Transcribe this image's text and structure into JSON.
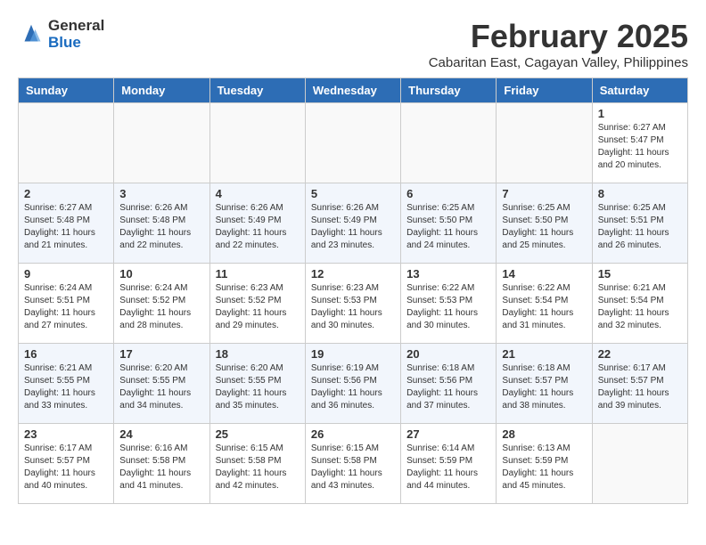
{
  "logo": {
    "general": "General",
    "blue": "Blue"
  },
  "title": "February 2025",
  "subtitle": "Cabaritan East, Cagayan Valley, Philippines",
  "headers": [
    "Sunday",
    "Monday",
    "Tuesday",
    "Wednesday",
    "Thursday",
    "Friday",
    "Saturday"
  ],
  "weeks": [
    [
      {
        "day": "",
        "info": ""
      },
      {
        "day": "",
        "info": ""
      },
      {
        "day": "",
        "info": ""
      },
      {
        "day": "",
        "info": ""
      },
      {
        "day": "",
        "info": ""
      },
      {
        "day": "",
        "info": ""
      },
      {
        "day": "1",
        "info": "Sunrise: 6:27 AM\nSunset: 5:47 PM\nDaylight: 11 hours and 20 minutes."
      }
    ],
    [
      {
        "day": "2",
        "info": "Sunrise: 6:27 AM\nSunset: 5:48 PM\nDaylight: 11 hours and 21 minutes."
      },
      {
        "day": "3",
        "info": "Sunrise: 6:26 AM\nSunset: 5:48 PM\nDaylight: 11 hours and 22 minutes."
      },
      {
        "day": "4",
        "info": "Sunrise: 6:26 AM\nSunset: 5:49 PM\nDaylight: 11 hours and 22 minutes."
      },
      {
        "day": "5",
        "info": "Sunrise: 6:26 AM\nSunset: 5:49 PM\nDaylight: 11 hours and 23 minutes."
      },
      {
        "day": "6",
        "info": "Sunrise: 6:25 AM\nSunset: 5:50 PM\nDaylight: 11 hours and 24 minutes."
      },
      {
        "day": "7",
        "info": "Sunrise: 6:25 AM\nSunset: 5:50 PM\nDaylight: 11 hours and 25 minutes."
      },
      {
        "day": "8",
        "info": "Sunrise: 6:25 AM\nSunset: 5:51 PM\nDaylight: 11 hours and 26 minutes."
      }
    ],
    [
      {
        "day": "9",
        "info": "Sunrise: 6:24 AM\nSunset: 5:51 PM\nDaylight: 11 hours and 27 minutes."
      },
      {
        "day": "10",
        "info": "Sunrise: 6:24 AM\nSunset: 5:52 PM\nDaylight: 11 hours and 28 minutes."
      },
      {
        "day": "11",
        "info": "Sunrise: 6:23 AM\nSunset: 5:52 PM\nDaylight: 11 hours and 29 minutes."
      },
      {
        "day": "12",
        "info": "Sunrise: 6:23 AM\nSunset: 5:53 PM\nDaylight: 11 hours and 30 minutes."
      },
      {
        "day": "13",
        "info": "Sunrise: 6:22 AM\nSunset: 5:53 PM\nDaylight: 11 hours and 30 minutes."
      },
      {
        "day": "14",
        "info": "Sunrise: 6:22 AM\nSunset: 5:54 PM\nDaylight: 11 hours and 31 minutes."
      },
      {
        "day": "15",
        "info": "Sunrise: 6:21 AM\nSunset: 5:54 PM\nDaylight: 11 hours and 32 minutes."
      }
    ],
    [
      {
        "day": "16",
        "info": "Sunrise: 6:21 AM\nSunset: 5:55 PM\nDaylight: 11 hours and 33 minutes."
      },
      {
        "day": "17",
        "info": "Sunrise: 6:20 AM\nSunset: 5:55 PM\nDaylight: 11 hours and 34 minutes."
      },
      {
        "day": "18",
        "info": "Sunrise: 6:20 AM\nSunset: 5:55 PM\nDaylight: 11 hours and 35 minutes."
      },
      {
        "day": "19",
        "info": "Sunrise: 6:19 AM\nSunset: 5:56 PM\nDaylight: 11 hours and 36 minutes."
      },
      {
        "day": "20",
        "info": "Sunrise: 6:18 AM\nSunset: 5:56 PM\nDaylight: 11 hours and 37 minutes."
      },
      {
        "day": "21",
        "info": "Sunrise: 6:18 AM\nSunset: 5:57 PM\nDaylight: 11 hours and 38 minutes."
      },
      {
        "day": "22",
        "info": "Sunrise: 6:17 AM\nSunset: 5:57 PM\nDaylight: 11 hours and 39 minutes."
      }
    ],
    [
      {
        "day": "23",
        "info": "Sunrise: 6:17 AM\nSunset: 5:57 PM\nDaylight: 11 hours and 40 minutes."
      },
      {
        "day": "24",
        "info": "Sunrise: 6:16 AM\nSunset: 5:58 PM\nDaylight: 11 hours and 41 minutes."
      },
      {
        "day": "25",
        "info": "Sunrise: 6:15 AM\nSunset: 5:58 PM\nDaylight: 11 hours and 42 minutes."
      },
      {
        "day": "26",
        "info": "Sunrise: 6:15 AM\nSunset: 5:58 PM\nDaylight: 11 hours and 43 minutes."
      },
      {
        "day": "27",
        "info": "Sunrise: 6:14 AM\nSunset: 5:59 PM\nDaylight: 11 hours and 44 minutes."
      },
      {
        "day": "28",
        "info": "Sunrise: 6:13 AM\nSunset: 5:59 PM\nDaylight: 11 hours and 45 minutes."
      },
      {
        "day": "",
        "info": ""
      }
    ]
  ]
}
